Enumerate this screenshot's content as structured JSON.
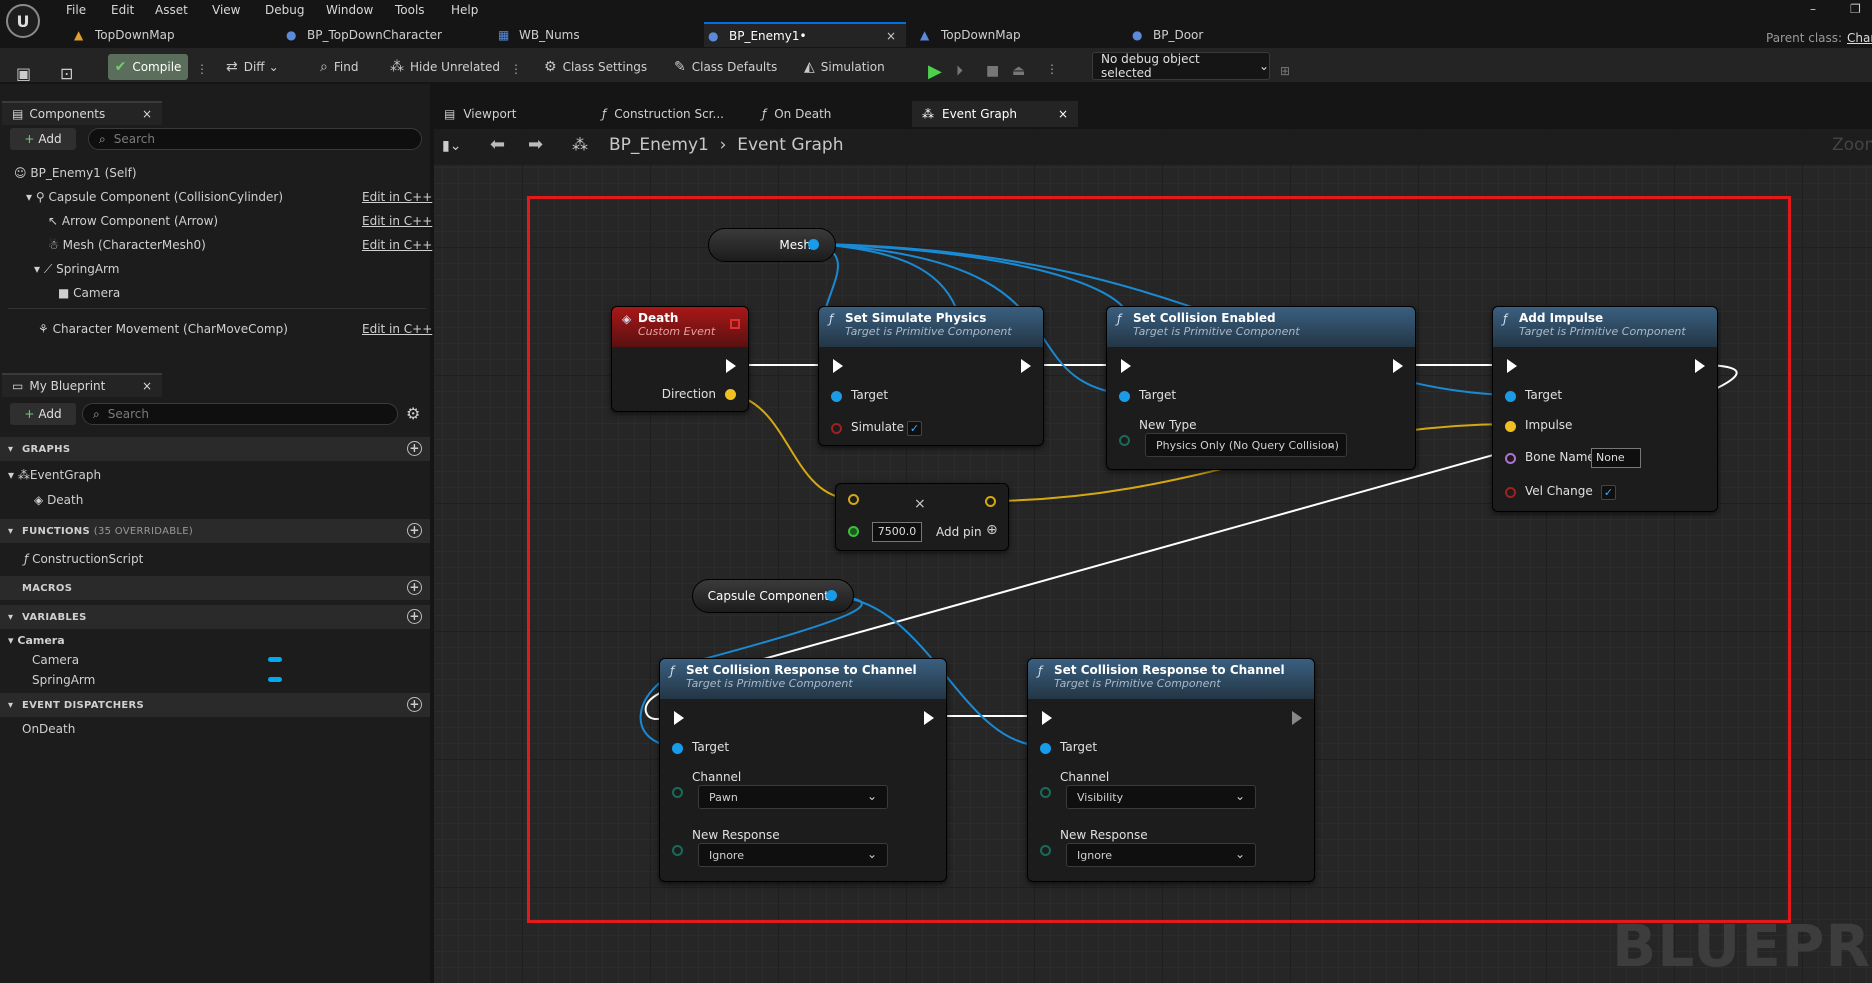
{
  "menu": [
    "File",
    "Edit",
    "Asset",
    "View",
    "Debug",
    "Window",
    "Tools",
    "Help"
  ],
  "doc_tabs": [
    "TopDownMap",
    "BP_TopDownCharacter",
    "WB_Nums",
    "BP_Enemy1•",
    "TopDownMap",
    "BP_Door"
  ],
  "parent_class": "Parent class:",
  "parent_class_value": "Char",
  "toolbar": {
    "compile": "Compile",
    "diff": "Diff",
    "find": "Find",
    "hide_unrelated": "Hide Unrelated",
    "class_settings": "Class Settings",
    "class_defaults": "Class Defaults",
    "simulation": "Simulation",
    "debug_object": "No debug object selected"
  },
  "components": {
    "tab": "Components",
    "add": "Add",
    "search_placeholder": "Search",
    "items": [
      {
        "label": "BP_Enemy1 (Self)"
      },
      {
        "label": "Capsule Component (CollisionCylinder)",
        "edit": "Edit in C++"
      },
      {
        "label": "Arrow Component (Arrow)",
        "edit": "Edit in C++"
      },
      {
        "label": "Mesh (CharacterMesh0)",
        "edit": "Edit in C++"
      },
      {
        "label": "SpringArm"
      },
      {
        "label": "Camera"
      },
      {
        "label": "Character Movement (CharMoveComp)",
        "edit": "Edit in C++"
      }
    ]
  },
  "my_blueprint": {
    "tab": "My Blueprint",
    "add": "Add",
    "search_placeholder": "Search",
    "graphs_header": "GRAPHS",
    "event_graph": "EventGraph",
    "death": "Death",
    "functions_header": "FUNCTIONS",
    "functions_count": "(35 OVERRIDABLE)",
    "construction_script": "ConstructionScript",
    "macros_header": "MACROS",
    "variables_header": "VARIABLES",
    "var_category": "Camera",
    "vars": [
      "Camera",
      "SpringArm"
    ],
    "dispatchers_header": "EVENT DISPATCHERS",
    "on_death": "OnDeath"
  },
  "graph_tabs": [
    "Viewport",
    "Construction Scr...",
    "On Death",
    "Event Graph"
  ],
  "breadcrumb": {
    "blueprint": "BP_Enemy1",
    "graph": "Event Graph"
  },
  "zoom_label": "Zoom",
  "watermark": "BLUEPRIN",
  "nodes": {
    "mesh": "Mesh",
    "death_title": "Death",
    "death_sub": "Custom Event",
    "direction": "Direction",
    "ssp_title": "Set Simulate Physics",
    "target_is": "Target is Primitive Component",
    "target": "Target",
    "simulate": "Simulate",
    "sce_title": "Set Collision Enabled",
    "new_type": "New Type",
    "new_type_value": "Physics Only (No Query Collision)",
    "ai_title": "Add Impulse",
    "impulse": "Impulse",
    "bone_name": "Bone Name",
    "bone_value": "None",
    "vel_change": "Vel Change",
    "mult_value": "7500.0",
    "add_pin": "Add pin",
    "capsule": "Capsule Component",
    "scr_title": "Set Collision Response to Channel",
    "channel": "Channel",
    "channel1": "Pawn",
    "channel2": "Visibility",
    "new_response": "New Response",
    "response1": "Ignore",
    "response2": "Ignore"
  }
}
